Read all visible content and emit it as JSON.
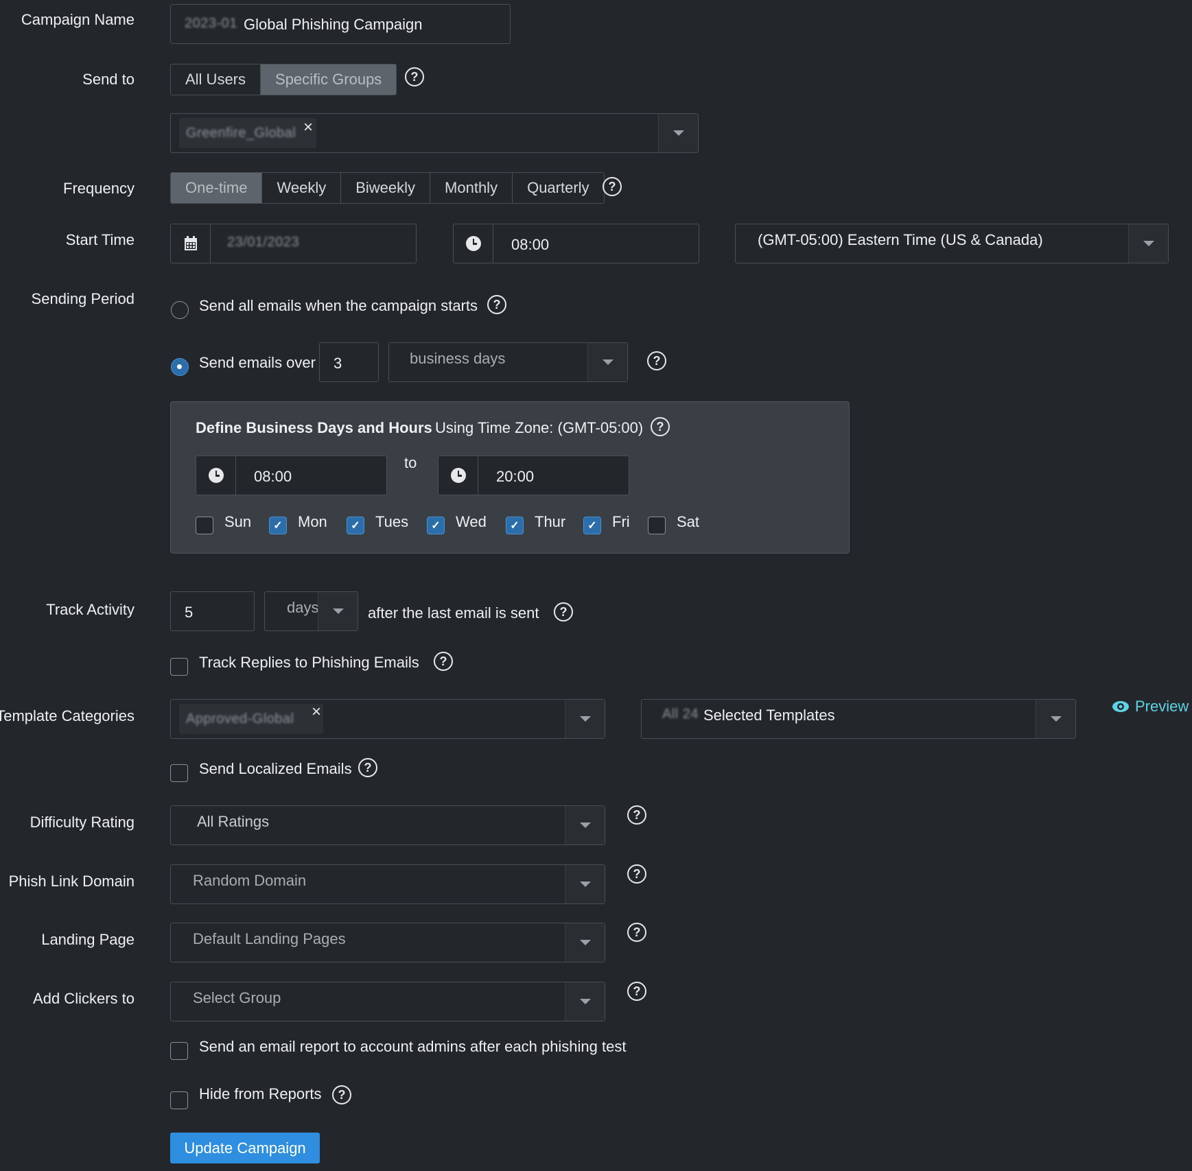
{
  "campaign_name": {
    "label": "Campaign Name",
    "prefix_redacted": "2023-01",
    "value": "Global Phishing Campaign"
  },
  "send_to": {
    "label": "Send to",
    "options": [
      "All Users",
      "Specific Groups"
    ],
    "selected": "Specific Groups",
    "group_chip": "Greenfire_Global"
  },
  "frequency": {
    "label": "Frequency",
    "options": [
      "One-time",
      "Weekly",
      "Biweekly",
      "Monthly",
      "Quarterly"
    ],
    "selected": "One-time"
  },
  "start_time": {
    "label": "Start Time",
    "date": "23/01/2023",
    "time": "08:00",
    "timezone": "(GMT-05:00) Eastern Time (US & Canada)"
  },
  "sending_period": {
    "label": "Sending Period",
    "option_all": "Send all emails when the campaign starts",
    "option_over": "Send emails over",
    "over_value": "3",
    "over_unit": "business days",
    "selected": "over"
  },
  "business_days": {
    "title": "Define Business Days and Hours",
    "tz_text": "Using Time Zone: (GMT-05:00)",
    "from": "08:00",
    "to_label": "to",
    "to": "20:00",
    "days": [
      {
        "label": "Sun",
        "checked": false
      },
      {
        "label": "Mon",
        "checked": true
      },
      {
        "label": "Tues",
        "checked": true
      },
      {
        "label": "Wed",
        "checked": true
      },
      {
        "label": "Thur",
        "checked": true
      },
      {
        "label": "Fri",
        "checked": true
      },
      {
        "label": "Sat",
        "checked": false
      }
    ]
  },
  "track_activity": {
    "label": "Track Activity",
    "value": "5",
    "unit": "days",
    "suffix": "after the last email is sent",
    "track_replies": "Track Replies to Phishing Emails"
  },
  "template_categories": {
    "label": "Template Categories",
    "chip": "Approved-Global",
    "templates_count_redacted": "All 24",
    "templates_text": "Selected Templates",
    "preview": "Preview",
    "send_localized": "Send Localized Emails"
  },
  "difficulty": {
    "label": "Difficulty Rating",
    "value": "All Ratings"
  },
  "phish_domain": {
    "label": "Phish Link Domain",
    "value": "Random Domain"
  },
  "landing_page": {
    "label": "Landing Page",
    "value": "Default Landing Pages"
  },
  "add_clickers": {
    "label": "Add Clickers to",
    "value": "Select Group"
  },
  "options": {
    "email_report": "Send an email report to account admins after each phishing test",
    "hide_reports": "Hide from Reports"
  },
  "submit": "Update Campaign",
  "colors": {
    "background": "#23272b",
    "primary": "#2f8ee0",
    "checked": "#2c6eaa",
    "preview": "#5fd3e6"
  }
}
